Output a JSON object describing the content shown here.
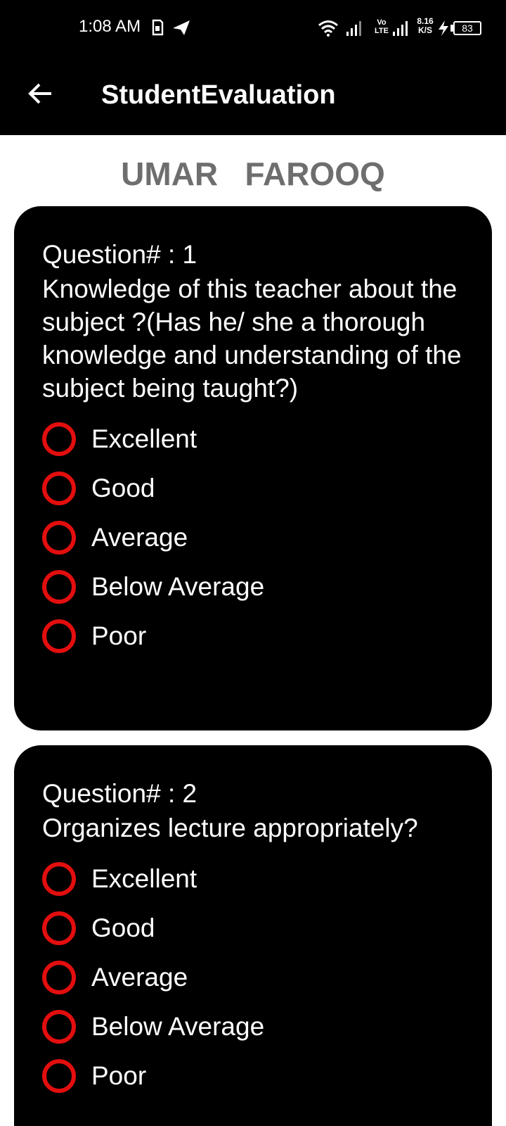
{
  "status_bar": {
    "time": "1:08 AM",
    "net_speed_value": "8.16",
    "net_speed_unit": "K/S",
    "volte_top": "Vo",
    "volte_bottom": "LTE",
    "battery": "83",
    "icons": [
      "sim-icon",
      "paper-plane-icon",
      "wifi-icon",
      "signal-icon",
      "signal-icon",
      "charging-icon",
      "battery-icon"
    ]
  },
  "app_bar": {
    "title": "StudentEvaluation",
    "back_icon": "arrow-left-icon"
  },
  "student": {
    "name": "UMAR   FAROOQ"
  },
  "colors": {
    "radio_border": "#e30e0e",
    "card_bg": "#000000",
    "name_color": "#6e6e6e"
  },
  "questions": [
    {
      "number": "Question# : 1",
      "text": "Knowledge of this teacher about the subject ?(Has he/ she a thorough knowledge and understanding of the subject being taught?)",
      "options": [
        "Excellent",
        "Good",
        "Average",
        "Below Average",
        "Poor"
      ]
    },
    {
      "number": "Question# : 2",
      "text": "Organizes lecture appropriately?",
      "options": [
        "Excellent",
        "Good",
        "Average",
        "Below Average",
        "Poor"
      ]
    }
  ]
}
